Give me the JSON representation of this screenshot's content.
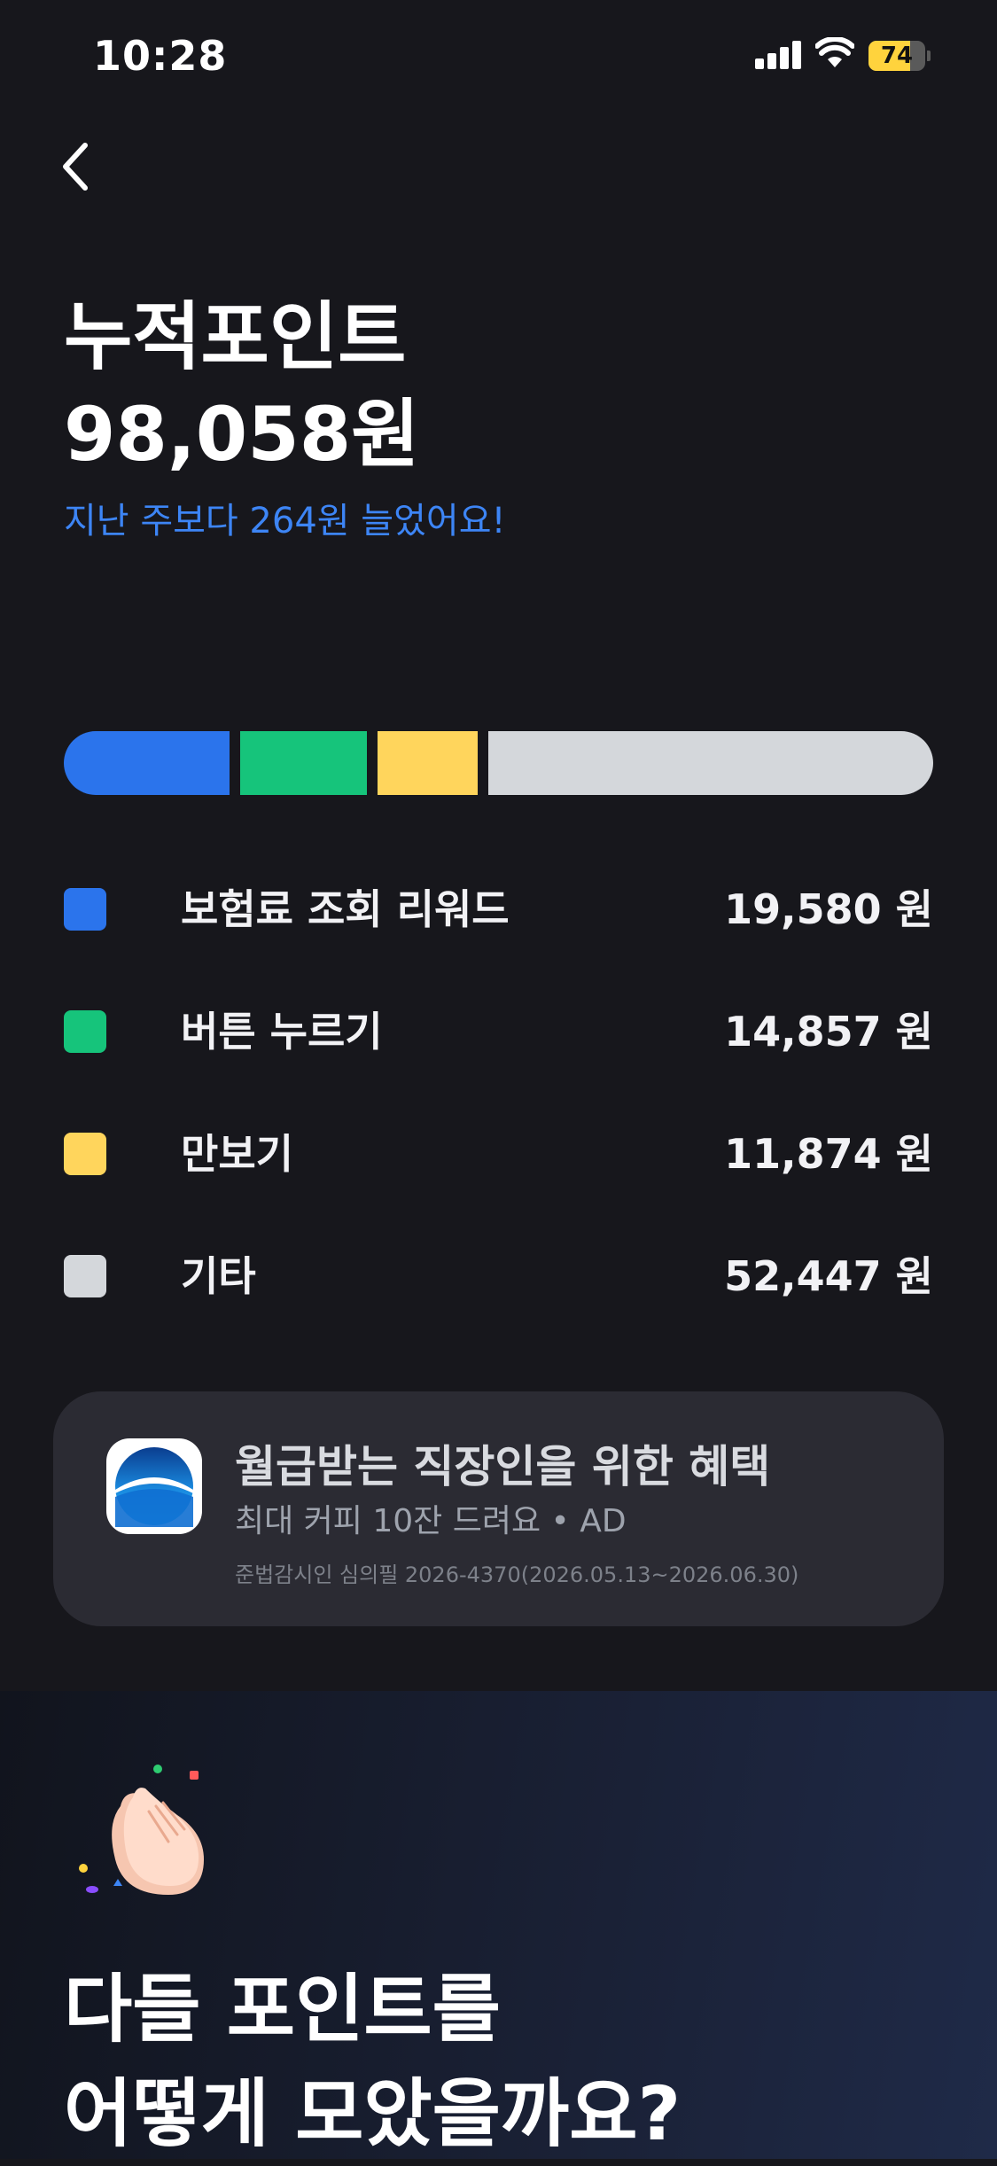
{
  "status_bar": {
    "time": "10:28",
    "battery_percent": 74,
    "battery_label": "74"
  },
  "header": {
    "back_icon": "chevron-left-icon"
  },
  "summary": {
    "title": "누적포인트",
    "amount": "98,058원",
    "delta_text": "지난 주보다 264원 늘었어요!"
  },
  "breakdown": {
    "items": [
      {
        "label": "보험료 조회 리워드",
        "value": "19,580 원",
        "amount": 19580,
        "color": "#2b74ec"
      },
      {
        "label": "버튼 누르기",
        "value": "14,857 원",
        "amount": 14857,
        "color": "#16c47b"
      },
      {
        "label": "만보기",
        "value": "11,874 원",
        "amount": 11874,
        "color": "#ffd55c"
      },
      {
        "label": "기타",
        "value": "52,447 원",
        "amount": 52447,
        "color": "#d4d7db"
      }
    ]
  },
  "ad": {
    "title": "월급받는 직장인을 위한 혜택",
    "subtitle": "최대 커피 10잔 드려요 • AD",
    "legal": "준법감시인 심의필 2026-4370(2026.05.13~2026.06.30)"
  },
  "promo": {
    "icon": "clapping-hands-icon",
    "headline_line1": "다들 포인트를",
    "headline_line2": "어떻게 모았을까요?"
  }
}
